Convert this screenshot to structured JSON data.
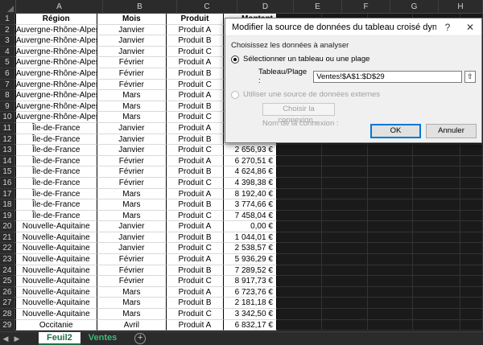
{
  "columns": [
    "A",
    "B",
    "C",
    "D",
    "E",
    "F",
    "G",
    "H"
  ],
  "table": {
    "headers": [
      "Région",
      "Mois",
      "Produit",
      "Montant"
    ],
    "rows": [
      [
        "Auvergne-Rhône-Alpes",
        "Janvier",
        "Produit A",
        ""
      ],
      [
        "Auvergne-Rhône-Alpes",
        "Janvier",
        "Produit B",
        ""
      ],
      [
        "Auvergne-Rhône-Alpes",
        "Janvier",
        "Produit C",
        ""
      ],
      [
        "Auvergne-Rhône-Alpes",
        "Février",
        "Produit A",
        ""
      ],
      [
        "Auvergne-Rhône-Alpes",
        "Février",
        "Produit B",
        ""
      ],
      [
        "Auvergne-Rhône-Alpes",
        "Février",
        "Produit C",
        ""
      ],
      [
        "Auvergne-Rhône-Alpes",
        "Mars",
        "Produit A",
        ""
      ],
      [
        "Auvergne-Rhône-Alpes",
        "Mars",
        "Produit B",
        ""
      ],
      [
        "Auvergne-Rhône-Alpes",
        "Mars",
        "Produit C",
        ""
      ],
      [
        "Île-de-France",
        "Janvier",
        "Produit A",
        ""
      ],
      [
        "Île-de-France",
        "Janvier",
        "Produit B",
        ""
      ],
      [
        "Île-de-France",
        "Janvier",
        "Produit C",
        "2 656,93 €"
      ],
      [
        "Île-de-France",
        "Février",
        "Produit A",
        "6 270,51 €"
      ],
      [
        "Île-de-France",
        "Février",
        "Produit B",
        "4 624,86 €"
      ],
      [
        "Île-de-France",
        "Février",
        "Produit C",
        "4 398,38 €"
      ],
      [
        "Île-de-France",
        "Mars",
        "Produit A",
        "8 192,40 €"
      ],
      [
        "Île-de-France",
        "Mars",
        "Produit B",
        "3 774,66 €"
      ],
      [
        "Île-de-France",
        "Mars",
        "Produit C",
        "7 458,04 €"
      ],
      [
        "Nouvelle-Aquitaine",
        "Janvier",
        "Produit A",
        "0,00 €"
      ],
      [
        "Nouvelle-Aquitaine",
        "Janvier",
        "Produit B",
        "1 044,01 €"
      ],
      [
        "Nouvelle-Aquitaine",
        "Janvier",
        "Produit C",
        "2 538,57 €"
      ],
      [
        "Nouvelle-Aquitaine",
        "Février",
        "Produit A",
        "5 936,29 €"
      ],
      [
        "Nouvelle-Aquitaine",
        "Février",
        "Produit B",
        "7 289,52 €"
      ],
      [
        "Nouvelle-Aquitaine",
        "Février",
        "Produit C",
        "8 917,73 €"
      ],
      [
        "Nouvelle-Aquitaine",
        "Mars",
        "Produit A",
        "6 723,76 €"
      ],
      [
        "Nouvelle-Aquitaine",
        "Mars",
        "Produit B",
        "2 181,18 €"
      ],
      [
        "Nouvelle-Aquitaine",
        "Mars",
        "Produit C",
        "3 342,50 €"
      ],
      [
        "Occitanie",
        "Avril",
        "Produit A",
        "6 832,17 €"
      ]
    ]
  },
  "tabs": [
    "Feuil2",
    "Ventes"
  ],
  "tabs_nav": {
    "prev": "◀",
    "next": "▶",
    "add": "+"
  },
  "dialog": {
    "title": "Modifier la source de données du tableau croisé dynamique",
    "help": "?",
    "close": "✕",
    "group_label": "Choisissez les données à analyser",
    "option_table": "Sélectionner un tableau ou une plage",
    "range_label": "Tableau/Plage :",
    "range_value": "Ventes!$A$1:$D$29",
    "collapse_icon": "⇧",
    "option_external": "Utiliser une source de données externes",
    "choose_connection": "Choisir la connexion...",
    "connection_name_label": "Nom de la connexion :",
    "ok": "OK",
    "cancel": "Annuler"
  },
  "colors": {
    "excel_green": "#1e7145",
    "dialog_accent": "#0078d7"
  }
}
